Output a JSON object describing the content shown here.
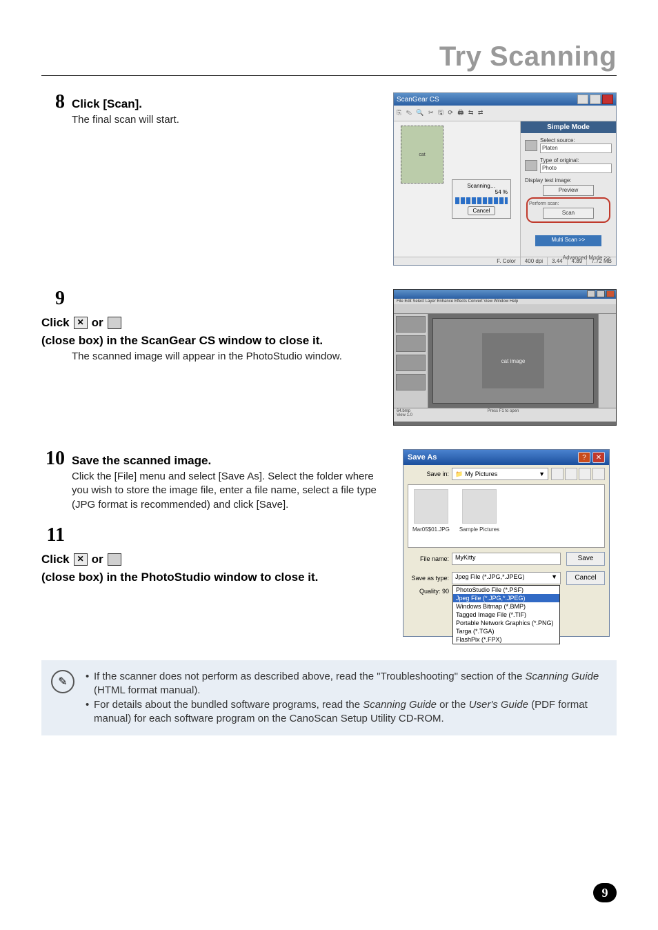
{
  "section_title": "Try Scanning",
  "page_number": "9",
  "step8": {
    "num": "8",
    "main": "Click [Scan].",
    "sub": "The final scan will start."
  },
  "step9": {
    "num": "9",
    "prefix": "Click ",
    "mid": " or ",
    "suffix": " (close box) in the ScanGear CS window to close it.",
    "sub": "The scanned image will appear in the PhotoStudio window."
  },
  "step10": {
    "num": "10",
    "main": "Save the scanned image.",
    "sub": "Click the [File] menu and select [Save As]. Select the folder where you wish to store the image file, enter a file name, select a file type (JPG format is recommended) and click [Save]."
  },
  "step11": {
    "num": "11",
    "prefix": "Click ",
    "mid": " or ",
    "suffix": " (close box) in the PhotoStudio window to close it."
  },
  "scangear": {
    "title": "ScanGear CS",
    "toolbar": "⎘ ✎ 🔍 ✂ 🖫 ⟳ 🖨 ⇆ ⇄",
    "prog_title": "Scanning…",
    "prog_pct": "54 %",
    "prog_cancel": "Cancel",
    "tab": "Simple Mode",
    "src_label": "Select source:",
    "src_value": "Platen",
    "type_label": "Type of original:",
    "type_value": "Photo",
    "disp_label": "Display test image:",
    "preview_btn": "Preview",
    "perform_label": "Perform scan:",
    "scan_btn": "Scan",
    "multi_btn": "Multi Scan >>",
    "adv": "Advanced Mode >>",
    "status": {
      "a": "F. Color",
      "b": "400 dpi",
      "c": "3.44",
      "d": "4.89",
      "e": "7.72 MB"
    },
    "preview_area": "cat"
  },
  "photostudio": {
    "menu": "File  Edit  Select  Layer  Enhance  Effects  Convert  View  Window  Help",
    "status1": "64.bmp",
    "status2": "Press F1 to open",
    "doc_placeholder": "cat image",
    "view": "View 1.0"
  },
  "saveas": {
    "title": "Save As",
    "savein_label": "Save in:",
    "savein_value": "My Pictures",
    "file1": "Mar05$01.JPG",
    "file2": "Sample Pictures",
    "filename_label": "File name:",
    "filename_value": "MyKitty",
    "saveastype_label": "Save as type:",
    "saveastype_value": "Jpeg File (*.JPG,*.JPEG)",
    "quality_label": "Quality: 90",
    "save_btn": "Save",
    "cancel_btn": "Cancel",
    "opts": {
      "o1": "PhotoStudio File (*.PSF)",
      "o2": "Jpeg File (*.JPG,*.JPEG)",
      "o3": "Windows Bitmap (*.BMP)",
      "o4": "Tagged Image File (*.TIF)",
      "o5": "Portable Network Graphics (*.PNG)",
      "o6": "Targa (*.TGA)",
      "o7": "FlashPix (*.FPX)"
    }
  },
  "note": {
    "line1_a": "If the scanner does not perform as described above, read the \"Troubleshooting\" section of the ",
    "line1_b": "Scanning Guide",
    "line1_c": " (HTML format manual).",
    "line2_a": "For details about the bundled software programs, read the ",
    "line2_b": "Scanning Guide",
    "line2_c": " or the ",
    "line2_d": "User's Guide",
    "line2_e": " (PDF format manual) for each software program on the CanoScan Setup Utility CD-ROM."
  }
}
